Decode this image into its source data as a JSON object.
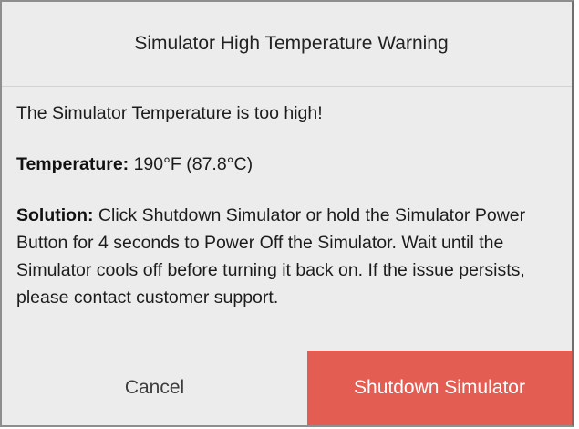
{
  "dialog": {
    "title": "Simulator High Temperature Warning",
    "message": "The Simulator Temperature is too high!",
    "temperature_label": "Temperature:",
    "temperature_value": " 190°F (87.8°C)",
    "solution_label": "Solution:",
    "solution_text": " Click Shutdown Simulator or hold the Simulator Power Button for 4 seconds to Power Off the Simulator. Wait until the Simulator cools off before turning it back on. If the issue persists, please contact customer support."
  },
  "buttons": {
    "cancel_label": "Cancel",
    "shutdown_label": "Shutdown Simulator"
  },
  "colors": {
    "dialog_background": "#ececec",
    "shutdown_button": "#e35d52",
    "shutdown_text": "#ffffff"
  }
}
